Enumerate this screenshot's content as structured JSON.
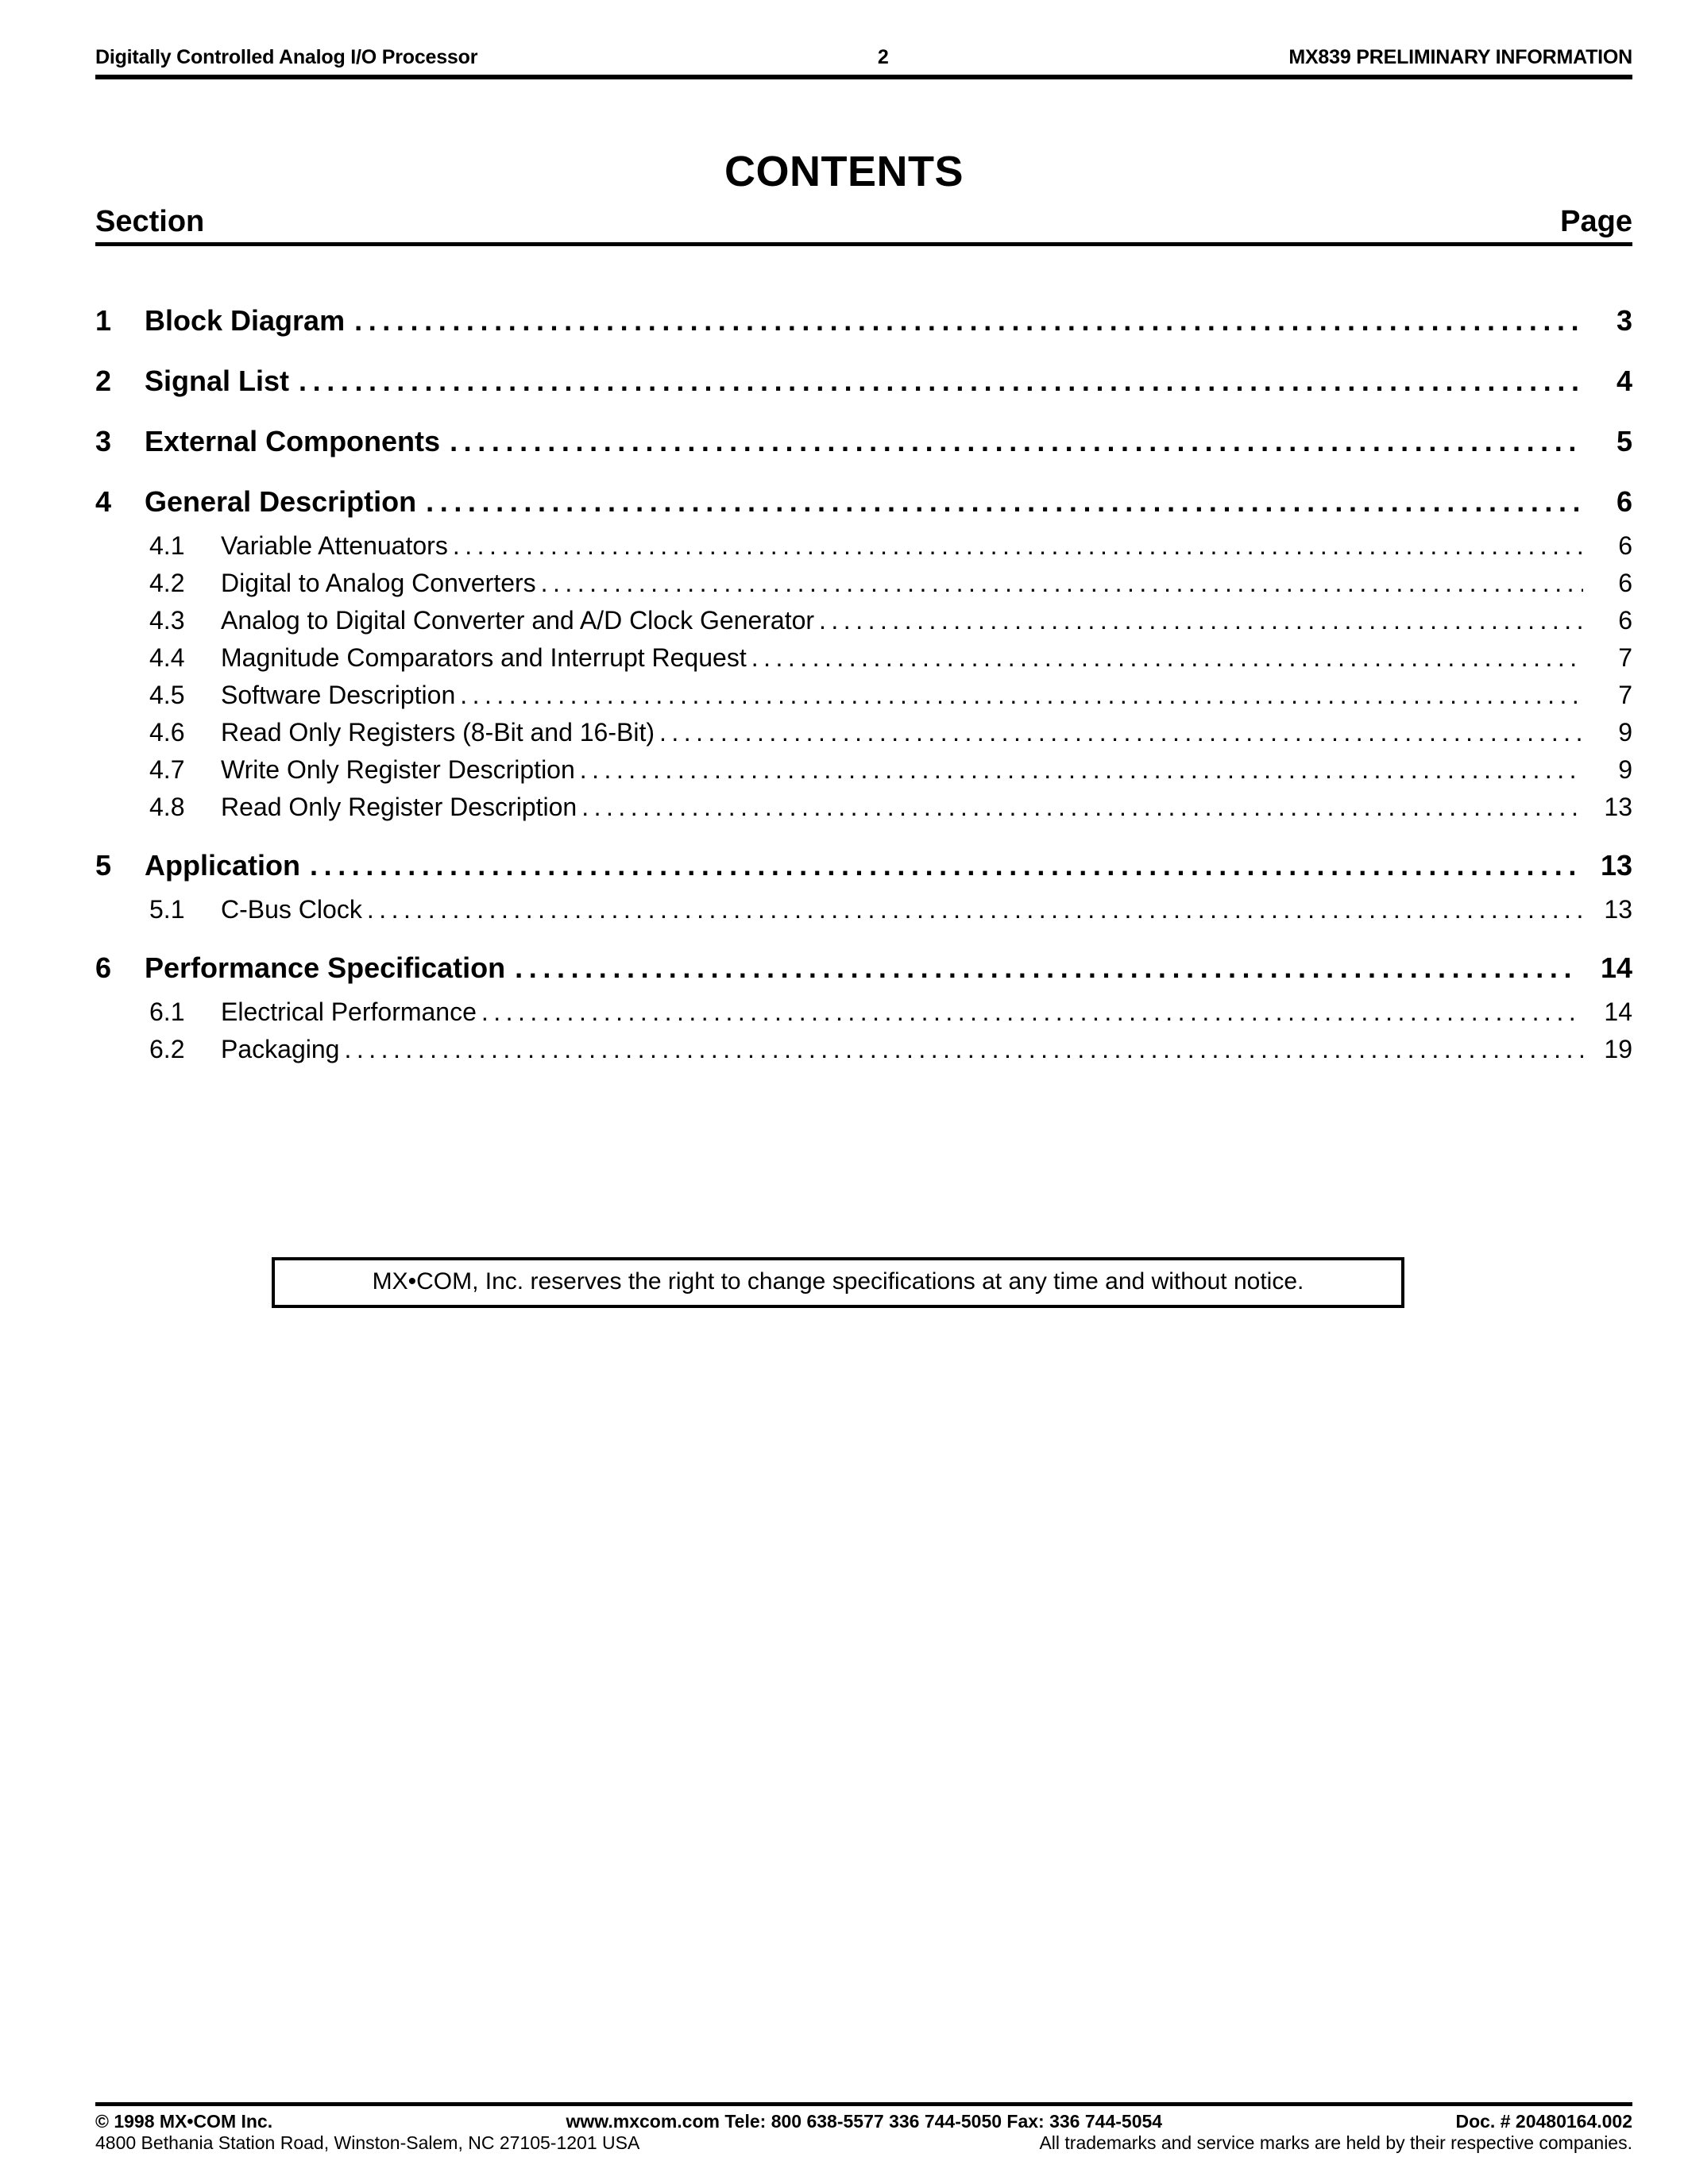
{
  "header": {
    "left": "Digitally Controlled Analog I/O Processor",
    "center": "2",
    "right": "MX839 PRELIMINARY INFORMATION"
  },
  "title": "CONTENTS",
  "column_heads": {
    "section": "Section",
    "page": "Page"
  },
  "toc": [
    {
      "level": 1,
      "number": "1",
      "label": "Block Diagram",
      "page": "3"
    },
    {
      "level": 1,
      "number": "2",
      "label": "Signal List",
      "page": "4"
    },
    {
      "level": 1,
      "number": "3",
      "label": "External Components",
      "page": "5"
    },
    {
      "level": 1,
      "number": "4",
      "label": "General Description",
      "page": "6"
    },
    {
      "level": 2,
      "number": "4.1",
      "label": "Variable Attenuators",
      "page": "6"
    },
    {
      "level": 2,
      "number": "4.2",
      "label": "Digital to Analog Converters",
      "page": "6"
    },
    {
      "level": 2,
      "number": "4.3",
      "label": "Analog to Digital Converter and A/D Clock Generator",
      "page": "6"
    },
    {
      "level": 2,
      "number": "4.4",
      "label": "Magnitude Comparators and Interrupt Request",
      "page": "7"
    },
    {
      "level": 2,
      "number": "4.5",
      "label": "Software Description",
      "page": "7"
    },
    {
      "level": 2,
      "number": "4.6",
      "label": "Read Only Registers (8-Bit and 16-Bit)",
      "page": "9"
    },
    {
      "level": 2,
      "number": "4.7",
      "label": "Write Only Register Description",
      "page": "9"
    },
    {
      "level": 2,
      "number": "4.8",
      "label": "Read Only Register Description",
      "page": "13"
    },
    {
      "level": 1,
      "number": "5",
      "label": "Application",
      "page": "13"
    },
    {
      "level": 2,
      "number": "5.1",
      "label": "C-Bus Clock",
      "page": "13"
    },
    {
      "level": 1,
      "number": "6",
      "label": "Performance Specification",
      "page": "14"
    },
    {
      "level": 2,
      "number": "6.1",
      "label": "Electrical Performance",
      "page": "14"
    },
    {
      "level": 2,
      "number": "6.2",
      "label": "Packaging",
      "page": "19"
    }
  ],
  "notice": "MX•COM, Inc. reserves the right to change specifications at any time and without notice.",
  "footer": {
    "line1_left": "© 1998 MX•COM Inc.",
    "line1_center": "www.mxcom.com   Tele:  800 638-5577   336 744-5050    Fax:  336 744-5054",
    "line1_right": "Doc. # 20480164.002",
    "line2_left": "4800 Bethania Station Road,  Winston-Salem, NC 27105-1201  USA",
    "line2_right": "All trademarks and service marks are held by their respective companies."
  }
}
